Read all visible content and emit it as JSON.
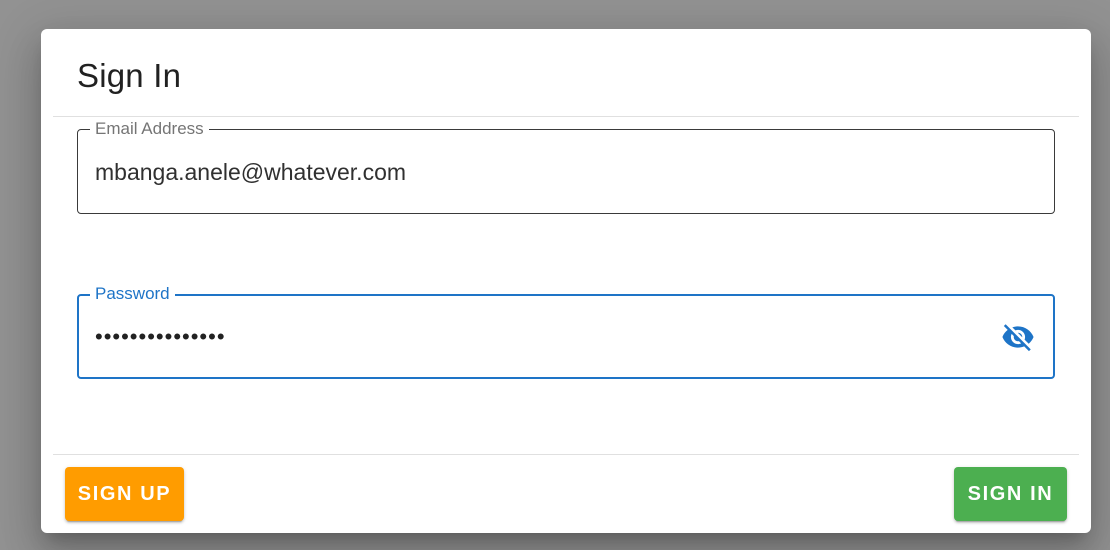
{
  "dialog": {
    "title": "Sign In"
  },
  "email": {
    "label": "Email Address",
    "value": "mbanga.anele@whatever.com"
  },
  "password": {
    "label": "Password",
    "masked_value": "•••••••••••••••",
    "toggle_icon": "visibility-off-icon"
  },
  "actions": {
    "signup_label": "SIGN UP",
    "signin_label": "SIGN IN"
  },
  "colors": {
    "accent": "#1e74c7",
    "signup": "#ff9c00",
    "signin": "#4caf50"
  }
}
